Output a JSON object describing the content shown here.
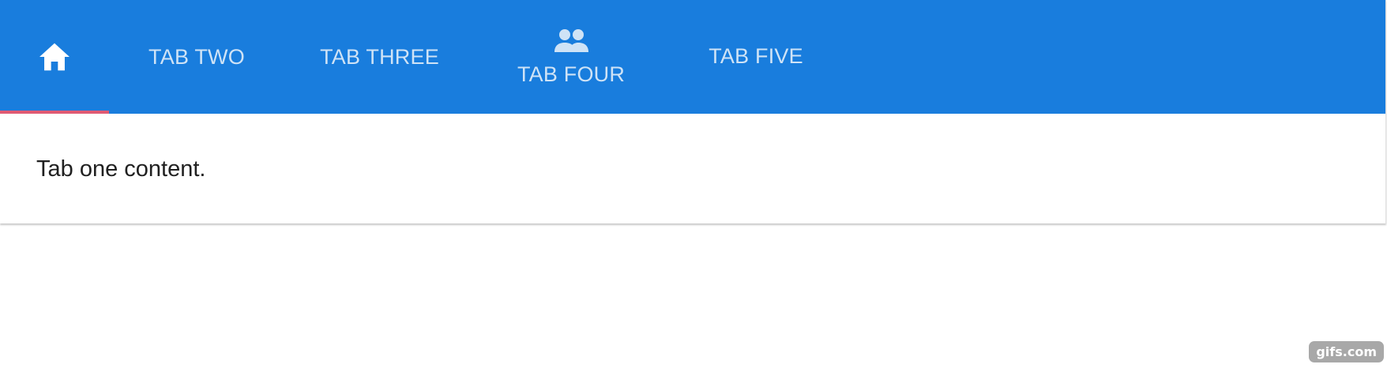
{
  "tabs": [
    {
      "id": "home",
      "icon": "home-icon",
      "label": "",
      "active": true
    },
    {
      "id": "two",
      "label": "TAB TWO",
      "active": false
    },
    {
      "id": "three",
      "label": "TAB THREE",
      "active": false
    },
    {
      "id": "four",
      "icon": "people-icon",
      "label": "TAB FOUR",
      "active": false
    },
    {
      "id": "five",
      "label": "TAB FIVE",
      "active": false
    }
  ],
  "content": {
    "text": "Tab one content."
  },
  "watermark": {
    "text": "gifs.com"
  },
  "colors": {
    "tabbar": "#197ddd",
    "indicator": "#e05a73",
    "active_text": "#ffffff",
    "inactive_text": "#cfe3f6"
  }
}
